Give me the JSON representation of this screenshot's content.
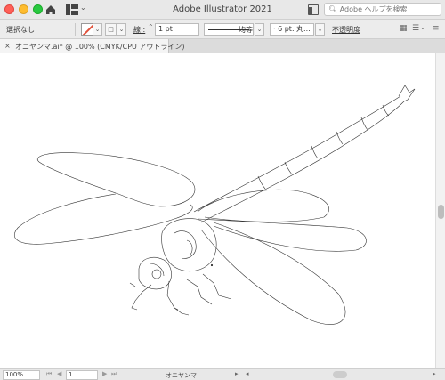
{
  "titlebar": {
    "app_title": "Adobe Illustrator 2021",
    "search_placeholder": "Adobe ヘルプを検索",
    "home_icon": "home-icon",
    "workspace_icon": "workspace-switcher-icon"
  },
  "controlbar": {
    "selection_label": "選択なし",
    "stroke_label": "線 :",
    "stroke_weight": "1 pt",
    "uniform_label": "均等",
    "brush_label": "6 pt. 丸...",
    "opacity_label": "不透明度"
  },
  "tab": {
    "close_glyph": "×",
    "document_title": "オニヤンマ.ai* @ 100% (CMYK/CPU アウトライン)"
  },
  "statusbar": {
    "zoom": "100%",
    "artboard_number": "1",
    "artboard_name": "オニヤンマ"
  },
  "colors": {
    "stroke_swatch": "#e0503a",
    "canvas_bg": "#ffffff",
    "outline": "#333333"
  }
}
